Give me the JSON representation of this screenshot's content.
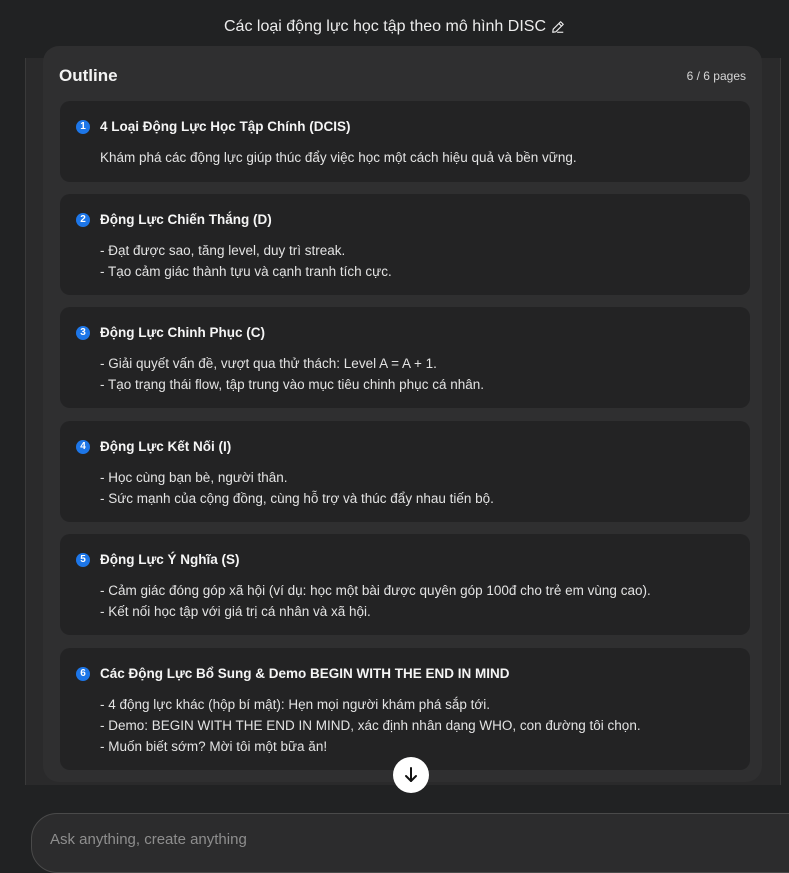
{
  "header": {
    "title": "Các loại động lực học tập theo mô hình DISC",
    "edit_icon": "pencil-icon"
  },
  "outline": {
    "title": "Outline",
    "page_count": "6 / 6 pages",
    "cards": [
      {
        "number": "1",
        "title": "4 Loại Động Lực Học Tập Chính (DCIS)",
        "lines": [
          "Khám phá các động lực giúp thúc đẩy việc học một cách hiệu quả và bền vững."
        ]
      },
      {
        "number": "2",
        "title": "Động Lực Chiến Thắng (D)",
        "lines": [
          "- Đạt được sao, tăng level, duy trì streak.",
          "- Tạo cảm giác thành tựu và cạnh tranh tích cực."
        ]
      },
      {
        "number": "3",
        "title": "Động Lực Chinh Phục (C)",
        "lines": [
          "- Giải quyết vấn đề, vượt qua thử thách: Level A = A + 1.",
          "- Tạo trạng thái flow, tập trung vào mục tiêu chinh phục cá nhân."
        ]
      },
      {
        "number": "4",
        "title": "Động Lực Kết Nối (I)",
        "lines": [
          "- Học cùng bạn bè, người thân.",
          "- Sức mạnh của cộng đồng, cùng hỗ trợ và thúc đẩy nhau tiến bộ."
        ]
      },
      {
        "number": "5",
        "title": "Động Lực Ý Nghĩa (S)",
        "lines": [
          "- Cảm giác đóng góp xã hội (ví dụ: học một bài được quyên góp 100đ cho trẻ em vùng cao).",
          "- Kết nối học tập với giá trị cá nhân và xã hội."
        ]
      },
      {
        "number": "6",
        "title": "Các Động Lực Bổ Sung & Demo BEGIN WITH THE END IN MIND",
        "lines": [
          "- 4 động lực khác (hộp bí mật): Hẹn mọi người khám phá sắp tới.",
          "- Demo: BEGIN WITH THE END IN MIND, xác định nhân dạng WHO, con đường tôi chọn.",
          "- Muốn biết sớm? Mời tôi một bữa ăn!"
        ]
      }
    ]
  },
  "scroll_button": {
    "icon": "arrow-down-icon"
  },
  "composer": {
    "placeholder": "Ask anything, create anything"
  },
  "colors": {
    "accent": "#1d76e8",
    "background": "#212223",
    "card": "#232324",
    "panel": "#2f2f30"
  }
}
